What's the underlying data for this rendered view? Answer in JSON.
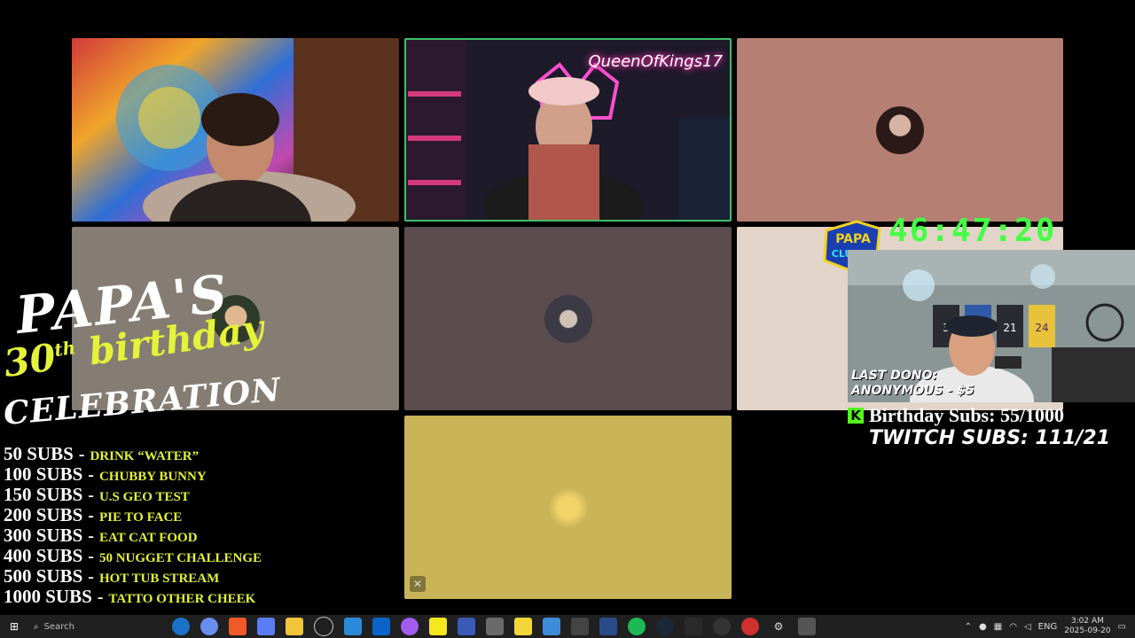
{
  "participants": [
    {
      "id": "p1",
      "name_tag": ""
    },
    {
      "id": "p2",
      "name_tag": "QueenOfKings17"
    },
    {
      "id": "p3",
      "name_tag": ""
    },
    {
      "id": "p4",
      "name_tag": ""
    },
    {
      "id": "p5",
      "name_tag": ""
    },
    {
      "id": "p6",
      "name_tag": ""
    },
    {
      "id": "p7",
      "name_tag": ""
    }
  ],
  "overlay": {
    "title_line1": "PAPA'S",
    "title_line2_num": "30",
    "title_line2_sup": "th",
    "title_line2_word": "birthday",
    "title_line3": "CELEBRATION",
    "goals": [
      {
        "subs": "50 SUBS",
        "reward": "DRINK “WATER”"
      },
      {
        "subs": "100 SUBS",
        "reward": "CHUBBY BUNNY"
      },
      {
        "subs": "150 SUBS",
        "reward": "U.S GEO TEST"
      },
      {
        "subs": "200 SUBS",
        "reward": "PIE TO FACE"
      },
      {
        "subs": "300 SUBS",
        "reward": "EAT CAT FOOD"
      },
      {
        "subs": "400 SUBS",
        "reward": "50 NUGGET CHALLENGE"
      },
      {
        "subs": "500 SUBS",
        "reward": "HOT TUB STREAM"
      },
      {
        "subs": "1000 SUBS",
        "reward": "TATTO OTHER CHEEK"
      }
    ],
    "timer": "46:47:20",
    "logo_text_1": "PAPA",
    "logo_text_2": "CLUTCH",
    "last_dono_label": "LAST DONO:",
    "last_dono_value": "ANONYMOUS - $5",
    "birthday_subs": "Birthday Subs: 55/1000",
    "twitch_subs": "TWITCH SUBS: 111/21",
    "k_label": "K",
    "cam_jerseys": [
      "3",
      "21",
      "24"
    ]
  },
  "taskbar": {
    "search_placeholder": "Search",
    "lang": "ENG",
    "time": "3:02 AM",
    "date": "2025-09-20"
  },
  "colors": {
    "accent_green": "#44ff44",
    "overlay_yellow": "#e4f23a",
    "tile_rose": "#b57f74",
    "tile_gray": "#857d73",
    "tile_plum": "#5b4c4f",
    "tile_cream": "#e3d4c9",
    "tile_gold": "#c9b458"
  }
}
